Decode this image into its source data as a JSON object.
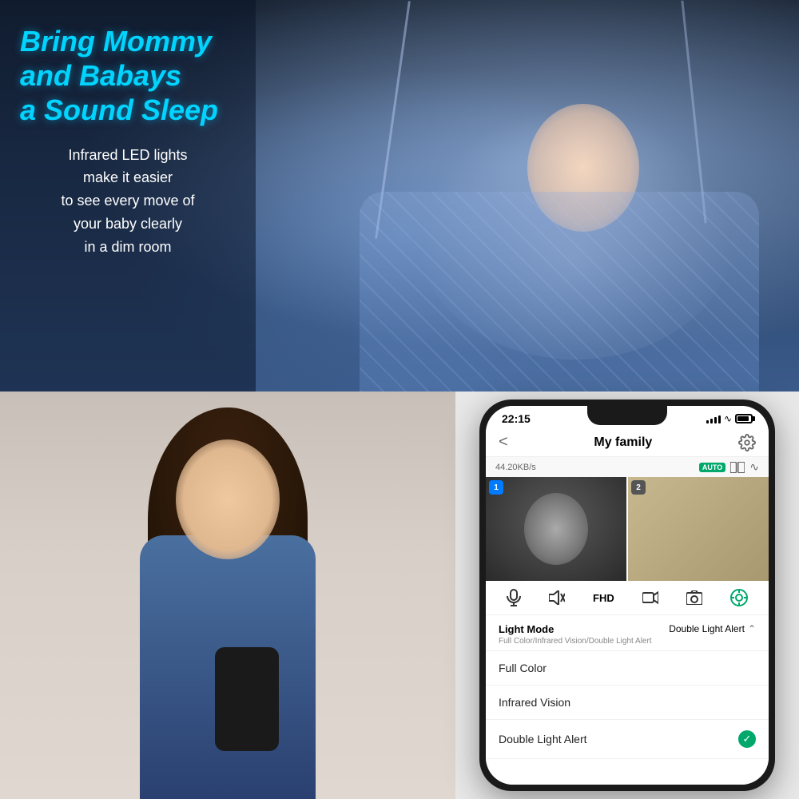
{
  "top": {
    "headline": "Bring Mommy\nand Babays\na Sound Sleep",
    "subtext": "Infrared LED lights\nmake it easier\nto see every move of\nyour baby clearly\nin a dim room"
  },
  "phone": {
    "status_time": "22:15",
    "speed": "44.20KB/s",
    "app_title": "My family",
    "back_label": "<",
    "auto_badge": "AUTO",
    "feed1_num": "1",
    "feed2_num": "2",
    "light_mode_title": "Light Mode",
    "light_mode_sub": "Full Color/Infrared Vision/Double Light Alert",
    "light_mode_current": "Double Light Alert",
    "menu_items": [
      {
        "label": "Full Color",
        "checked": false
      },
      {
        "label": "Infrared Vision",
        "checked": false
      },
      {
        "label": "Double Light Alert",
        "checked": true
      }
    ],
    "controls": {
      "mic": "🎤",
      "speaker": "🔇",
      "quality": "FHD",
      "record": "⬜",
      "camera": "📷",
      "settings": "⚙"
    }
  }
}
